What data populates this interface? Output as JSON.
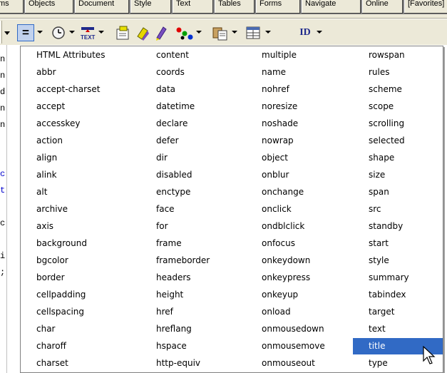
{
  "tabs": [
    "ms",
    "Objects",
    "Document",
    "Style",
    "Text",
    "Tables",
    "Forms",
    "Navigate",
    "Online",
    "[Favorites]"
  ],
  "toolbar": {
    "equals_label": "=",
    "id_label": "ID",
    "icons": [
      "clock-icon",
      "text-insert-icon",
      "image-icon",
      "highlight-icon",
      "pen-icon",
      "color-dots-icon",
      "paste-icon",
      "table-icon"
    ]
  },
  "menu": {
    "columns": [
      [
        "HTML Attributes",
        "abbr",
        "accept-charset",
        "accept",
        "accesskey",
        "action",
        "align",
        "alink",
        "alt",
        "archive",
        "axis",
        "background",
        "bgcolor",
        "border",
        "cellpadding",
        "cellspacing",
        "char",
        "charoff",
        "charset"
      ],
      [
        "content",
        "coords",
        "data",
        "datetime",
        "declare",
        "defer",
        "dir",
        "disabled",
        "enctype",
        "face",
        "for",
        "frame",
        "frameborder",
        "headers",
        "height",
        "href",
        "hreflang",
        "hspace",
        "http-equiv"
      ],
      [
        "multiple",
        "name",
        "nohref",
        "noresize",
        "noshade",
        "nowrap",
        "object",
        "onblur",
        "onchange",
        "onclick",
        "ondblclick",
        "onfocus",
        "onkeydown",
        "onkeypress",
        "onkeyup",
        "onload",
        "onmousedown",
        "onmousemove",
        "onmouseout"
      ],
      [
        "rowspan",
        "rules",
        "scheme",
        "scope",
        "scrolling",
        "selected",
        "shape",
        "size",
        "span",
        "src",
        "standby",
        "start",
        "style",
        "summary",
        "tabindex",
        "target",
        "text",
        "title",
        "type"
      ]
    ],
    "selected": "title"
  },
  "editor_fragments": [
    {
      "text": "n",
      "row": 1,
      "color": "black"
    },
    {
      "text": "n",
      "row": 2,
      "color": "black"
    },
    {
      "text": "d",
      "row": 3,
      "color": "black"
    },
    {
      "text": "n",
      "row": 4,
      "color": "black"
    },
    {
      "text": "n",
      "row": 5,
      "color": "black"
    },
    {
      "text": "c",
      "row": 8,
      "color": "blue"
    },
    {
      "text": "t",
      "row": 9,
      "color": "blue"
    },
    {
      "text": "c",
      "row": 11,
      "color": "black"
    },
    {
      "text": "i",
      "row": 13,
      "color": "black"
    },
    {
      "text": ";",
      "row": 14,
      "color": "black"
    }
  ],
  "colors": {
    "selection": "#316ac5",
    "toolbar": "#ece9d8",
    "border": "#808080",
    "blue_code": "#0000cc"
  }
}
